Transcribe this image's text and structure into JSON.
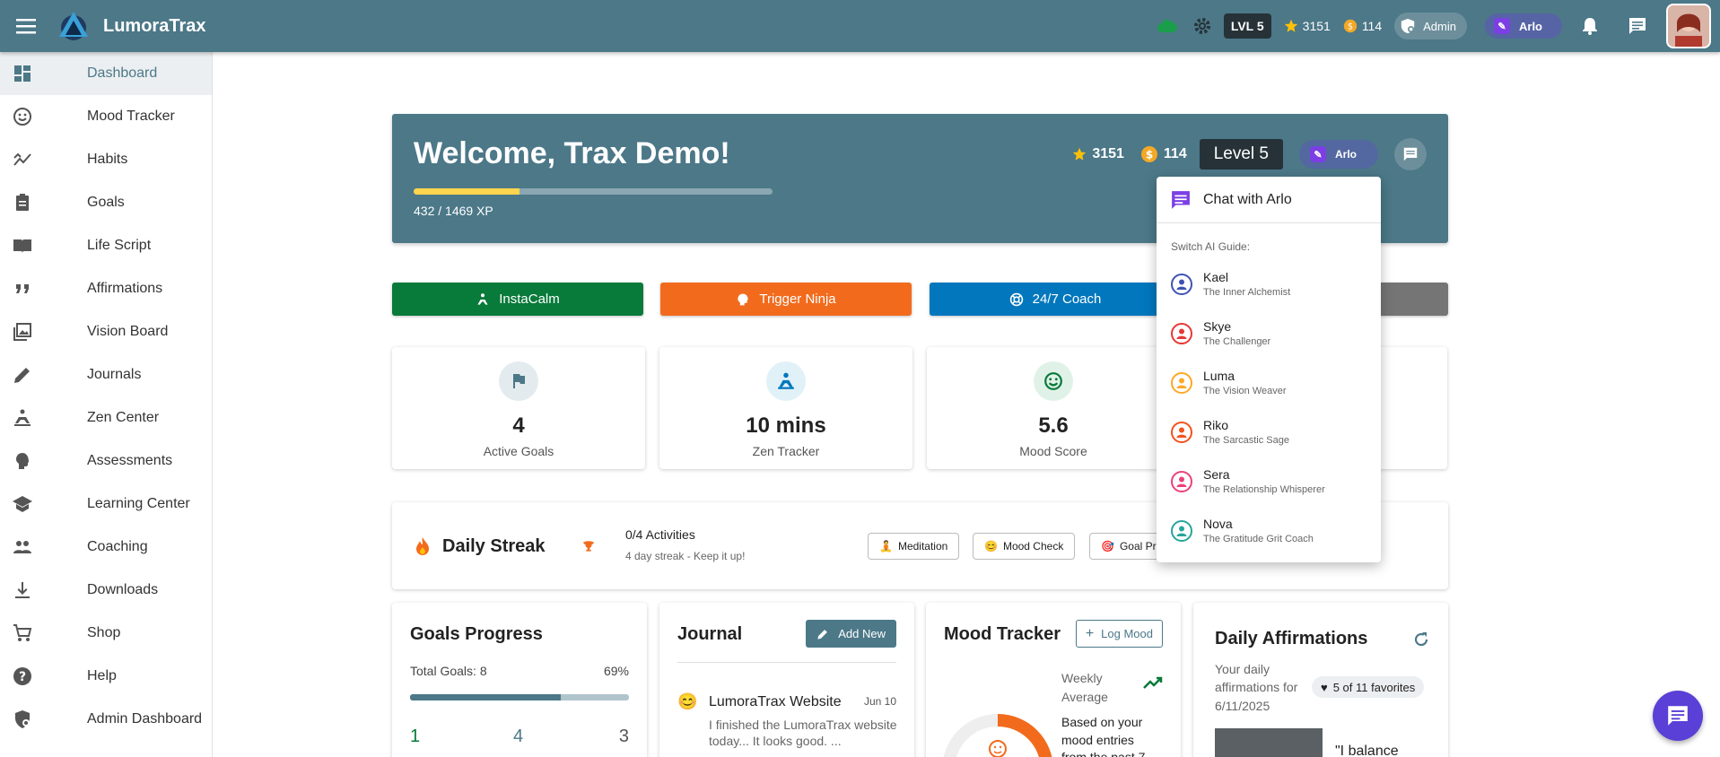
{
  "app": {
    "title": "LumoraTrax"
  },
  "topbar": {
    "level": "LVL 5",
    "stars": "3151",
    "coins": "114",
    "admin_label": "Admin",
    "guide_label": "Arlo"
  },
  "sidebar": {
    "items": [
      {
        "label": "Dashboard",
        "icon": "dashboard-icon"
      },
      {
        "label": "Mood Tracker",
        "icon": "smiley-icon"
      },
      {
        "label": "Habits",
        "icon": "trend-icon"
      },
      {
        "label": "Goals",
        "icon": "clipboard-icon"
      },
      {
        "label": "Life Script",
        "icon": "book-icon"
      },
      {
        "label": "Affirmations",
        "icon": "quote-icon"
      },
      {
        "label": "Vision Board",
        "icon": "images-icon"
      },
      {
        "label": "Journals",
        "icon": "pencil-icon"
      },
      {
        "label": "Zen Center",
        "icon": "meditation-icon"
      },
      {
        "label": "Assessments",
        "icon": "brain-icon"
      },
      {
        "label": "Learning Center",
        "icon": "school-icon"
      },
      {
        "label": "Coaching",
        "icon": "people-icon"
      },
      {
        "label": "Downloads",
        "icon": "download-icon"
      },
      {
        "label": "Shop",
        "icon": "cart-icon"
      },
      {
        "label": "Help",
        "icon": "help-icon"
      },
      {
        "label": "Admin Dashboard",
        "icon": "admin-shield-icon"
      }
    ]
  },
  "hero": {
    "welcome": "Welcome, Trax Demo!",
    "xp_text": "432 / 1469 XP",
    "xp_progress": 0.294,
    "stars": "3151",
    "coins": "114",
    "level": "Level 5",
    "guide": "Arlo"
  },
  "actions": [
    {
      "label": "InstaCalm",
      "color": "#087a3a"
    },
    {
      "label": "Trigger Ninja",
      "color": "#f26b1d"
    },
    {
      "label": "24/7 Coach",
      "color": "#0277bd"
    },
    {
      "label": "",
      "color": "#757575"
    }
  ],
  "stats": [
    {
      "value": "4",
      "label": "Active Goals",
      "icon": "flag-icon"
    },
    {
      "value": "10 mins",
      "label": "Zen Tracker",
      "icon": "meditation-icon"
    },
    {
      "value": "5.6",
      "label": "Mood Score",
      "icon": "smiley-icon"
    }
  ],
  "streak": {
    "title": "Daily Streak",
    "activities": "0/4 Activities",
    "sub": "4 day streak - Keep it up!",
    "chips": [
      "Meditation",
      "Mood Check",
      "Goal Pr"
    ]
  },
  "bottom": {
    "goals": {
      "title": "Goals Progress",
      "total": "Total Goals: 8",
      "percent": "69%",
      "progress": 0.69,
      "counts": [
        "1",
        "4",
        "3"
      ]
    },
    "journal": {
      "title": "Journal",
      "add": "Add New",
      "entry_title": "LumoraTrax Website",
      "entry_date": "Jun 10",
      "entry_text": "I finished the LumoraTrax website today... It looks good. ..."
    },
    "mood": {
      "title": "Mood Tracker",
      "log": "Log Mood",
      "weekly": "Weekly Average",
      "text": "Based on your mood entries from the past 7",
      "value": "5.6"
    },
    "affirm": {
      "title": "Daily Affirmations",
      "sub": "Your daily affirmations for 6/11/2025",
      "favs": "5 of 11 favorites",
      "quote": "\"I balance"
    }
  },
  "dropdown": {
    "chat": "Chat with Arlo",
    "switch_label": "Switch AI Guide:",
    "guides": [
      {
        "name": "Kael",
        "role": "The Inner Alchemist",
        "color": "#3f51b5"
      },
      {
        "name": "Skye",
        "role": "The Challenger",
        "color": "#e53935"
      },
      {
        "name": "Luma",
        "role": "The Vision Weaver",
        "color": "#ffa726"
      },
      {
        "name": "Riko",
        "role": "The Sarcastic Sage",
        "color": "#f4511e"
      },
      {
        "name": "Sera",
        "role": "The Relationship Whisperer",
        "color": "#ec407a"
      },
      {
        "name": "Nova",
        "role": "The Gratitude Grit Coach",
        "color": "#26a69a"
      }
    ]
  }
}
